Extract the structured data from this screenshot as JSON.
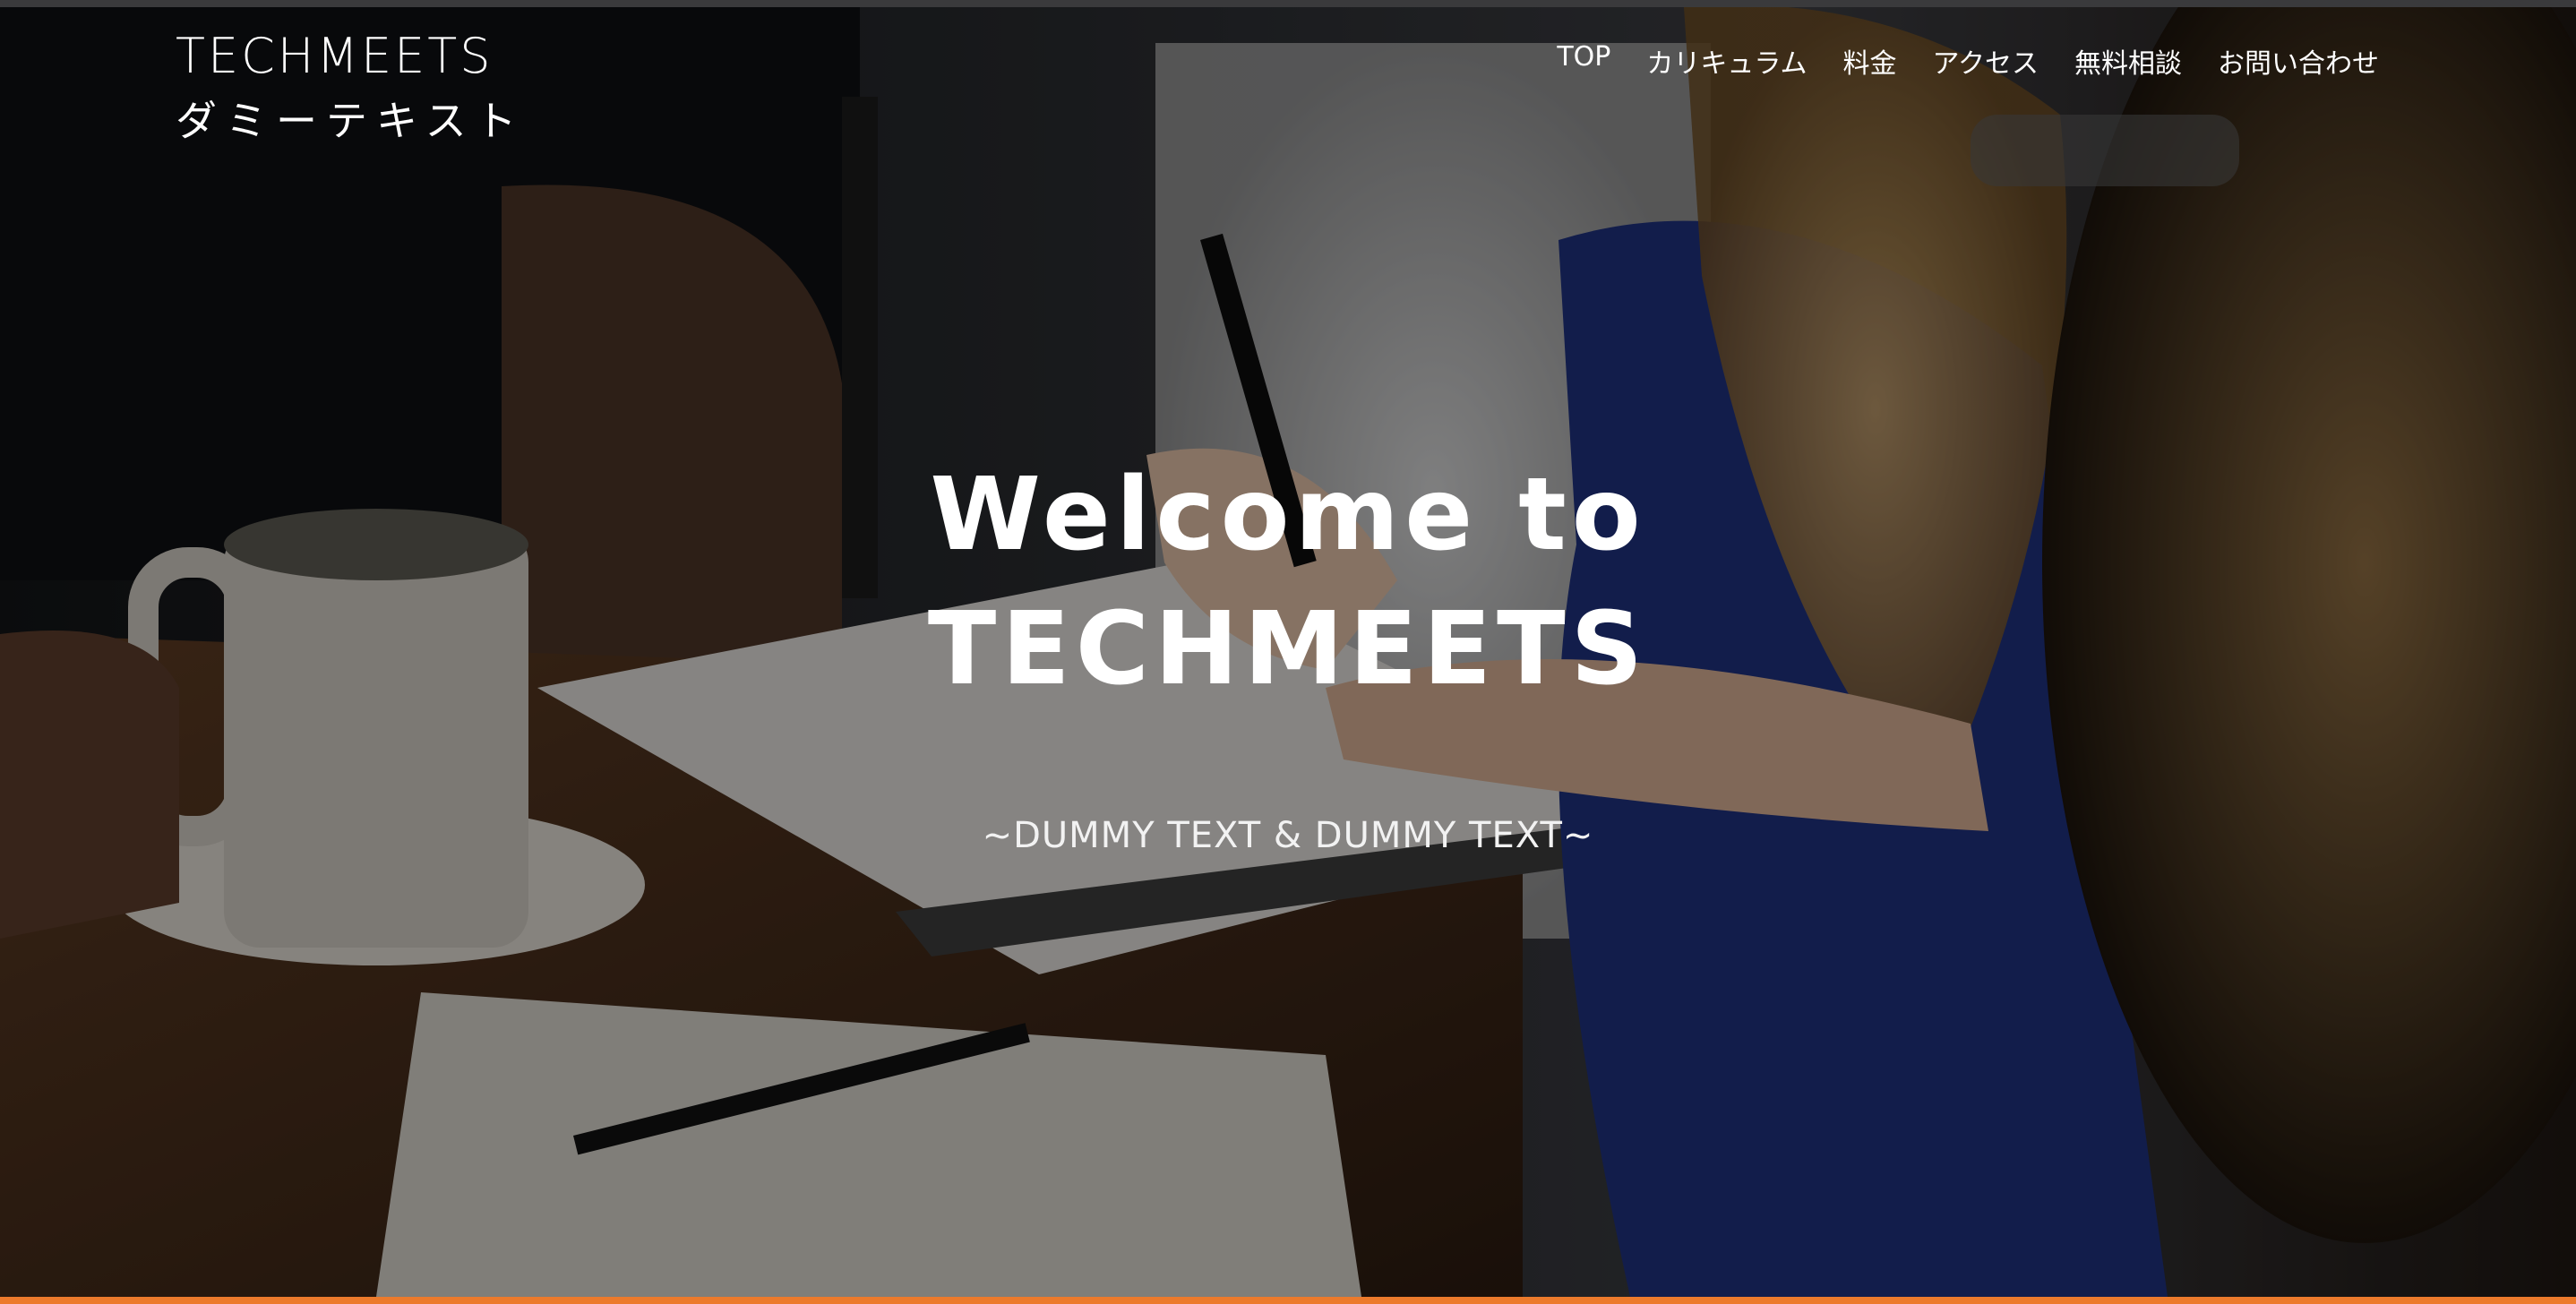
{
  "header": {
    "logo_title": "TECHMEETS",
    "logo_subtitle": "ダミーテキスト"
  },
  "nav": {
    "items": [
      "TOP",
      "カリキュラム",
      "料金",
      "アクセス",
      "無料相談",
      "お問い合わせ"
    ]
  },
  "hero": {
    "title_line1": "Welcome to",
    "title_line2": "TECHMEETS",
    "subtitle": "~DUMMY TEXT & DUMMY TEXT~"
  },
  "colors": {
    "accent_bar": "#ec7a2c",
    "text": "#ffffff"
  }
}
